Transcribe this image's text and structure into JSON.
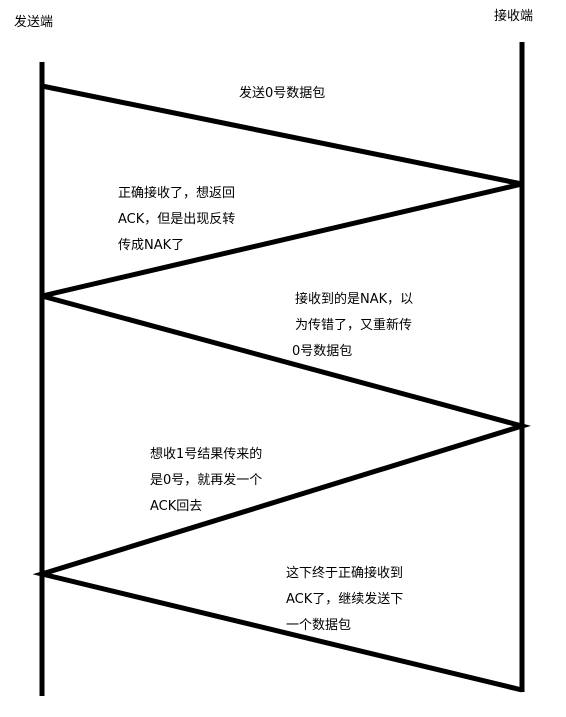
{
  "sender_label": "发送端",
  "receiver_label": "接收端",
  "messages": [
    {
      "lines": [
        "发送0号数据包"
      ]
    },
    {
      "lines": [
        "正确接收了，想返回",
        "ACK，但是出现反转",
        "传成NAK了"
      ]
    },
    {
      "lines": [
        "接收到的是NAK，以",
        "为传错了，又重新传",
        "0号数据包"
      ]
    },
    {
      "lines": [
        "想收1号结果传来的",
        "是0号，就再发一个",
        "ACK回去"
      ]
    },
    {
      "lines": [
        "这下终于正确接收到",
        "ACK了，继续发送下",
        "一个数据包"
      ]
    }
  ]
}
